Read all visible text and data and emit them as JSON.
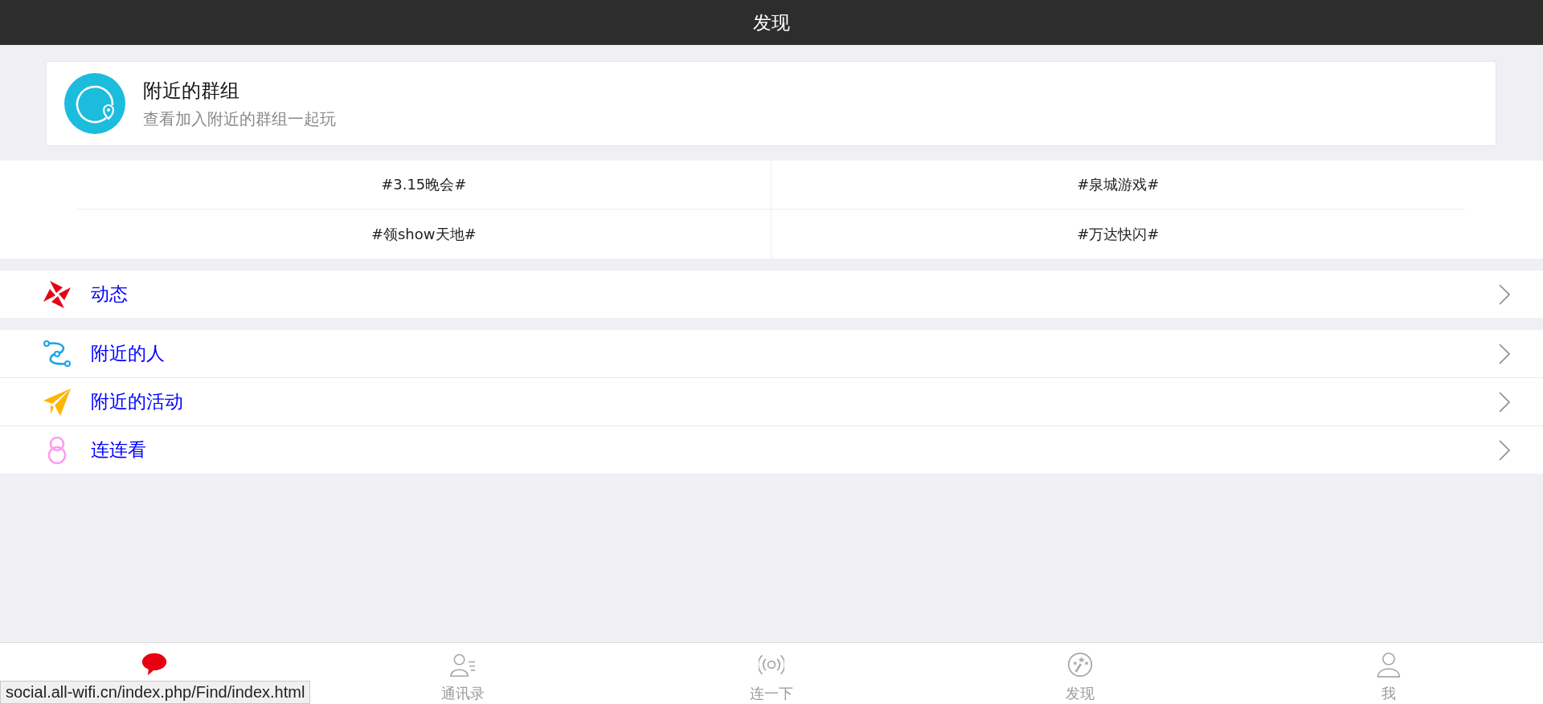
{
  "header": {
    "title": "发现"
  },
  "nearby_group": {
    "title": "附近的群组",
    "subtitle": "查看加入附近的群组一起玩"
  },
  "topics": [
    "#3.15晚会#",
    "#泉城游戏#",
    "#领show天地#",
    "#万达快闪#"
  ],
  "menu_sections": [
    {
      "items": [
        {
          "label": "动态"
        }
      ]
    },
    {
      "items": [
        {
          "label": "附近的人"
        },
        {
          "label": "附近的活动"
        },
        {
          "label": "连连看"
        }
      ]
    }
  ],
  "tabs": [
    {
      "selected": true
    },
    {
      "label": "通讯录",
      "selected": false
    },
    {
      "label": "连一下",
      "selected": false
    },
    {
      "label": "发现",
      "selected": false
    },
    {
      "label": "我",
      "selected": false
    }
  ],
  "status_bar": {
    "url": "social.all-wifi.cn/index.php/Find/index.html"
  }
}
